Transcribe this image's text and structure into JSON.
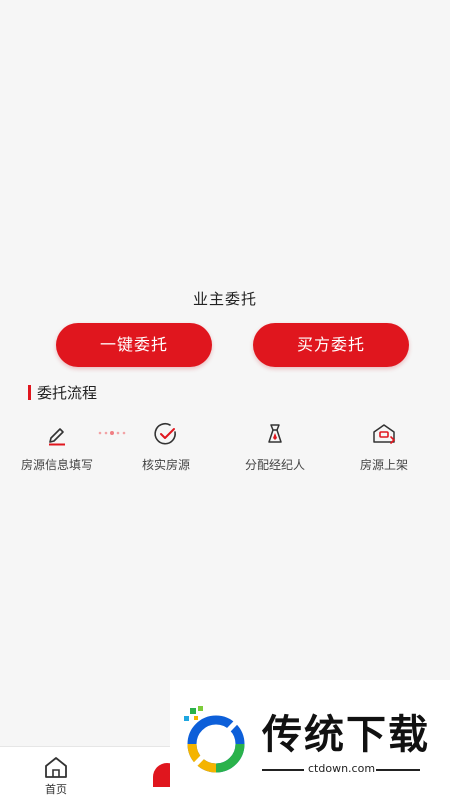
{
  "main": {
    "title": "业主委托",
    "buttons": {
      "one_key": "一键委托",
      "buy": "买方委托"
    },
    "section_title": "委托流程",
    "steps": [
      {
        "label": "房源信息填写",
        "icon": "pencil-icon"
      },
      {
        "label": "核实房源",
        "icon": "check-circle-icon"
      },
      {
        "label": "分配经纪人",
        "icon": "agent-icon"
      },
      {
        "label": "房源上架",
        "icon": "house-listing-icon"
      }
    ]
  },
  "tabbar": {
    "home_label": "首页"
  },
  "watermark": {
    "brand": "传统下载",
    "url": "ctdown.com"
  },
  "colors": {
    "accent": "#e0161e",
    "background": "#f6f6f6"
  }
}
